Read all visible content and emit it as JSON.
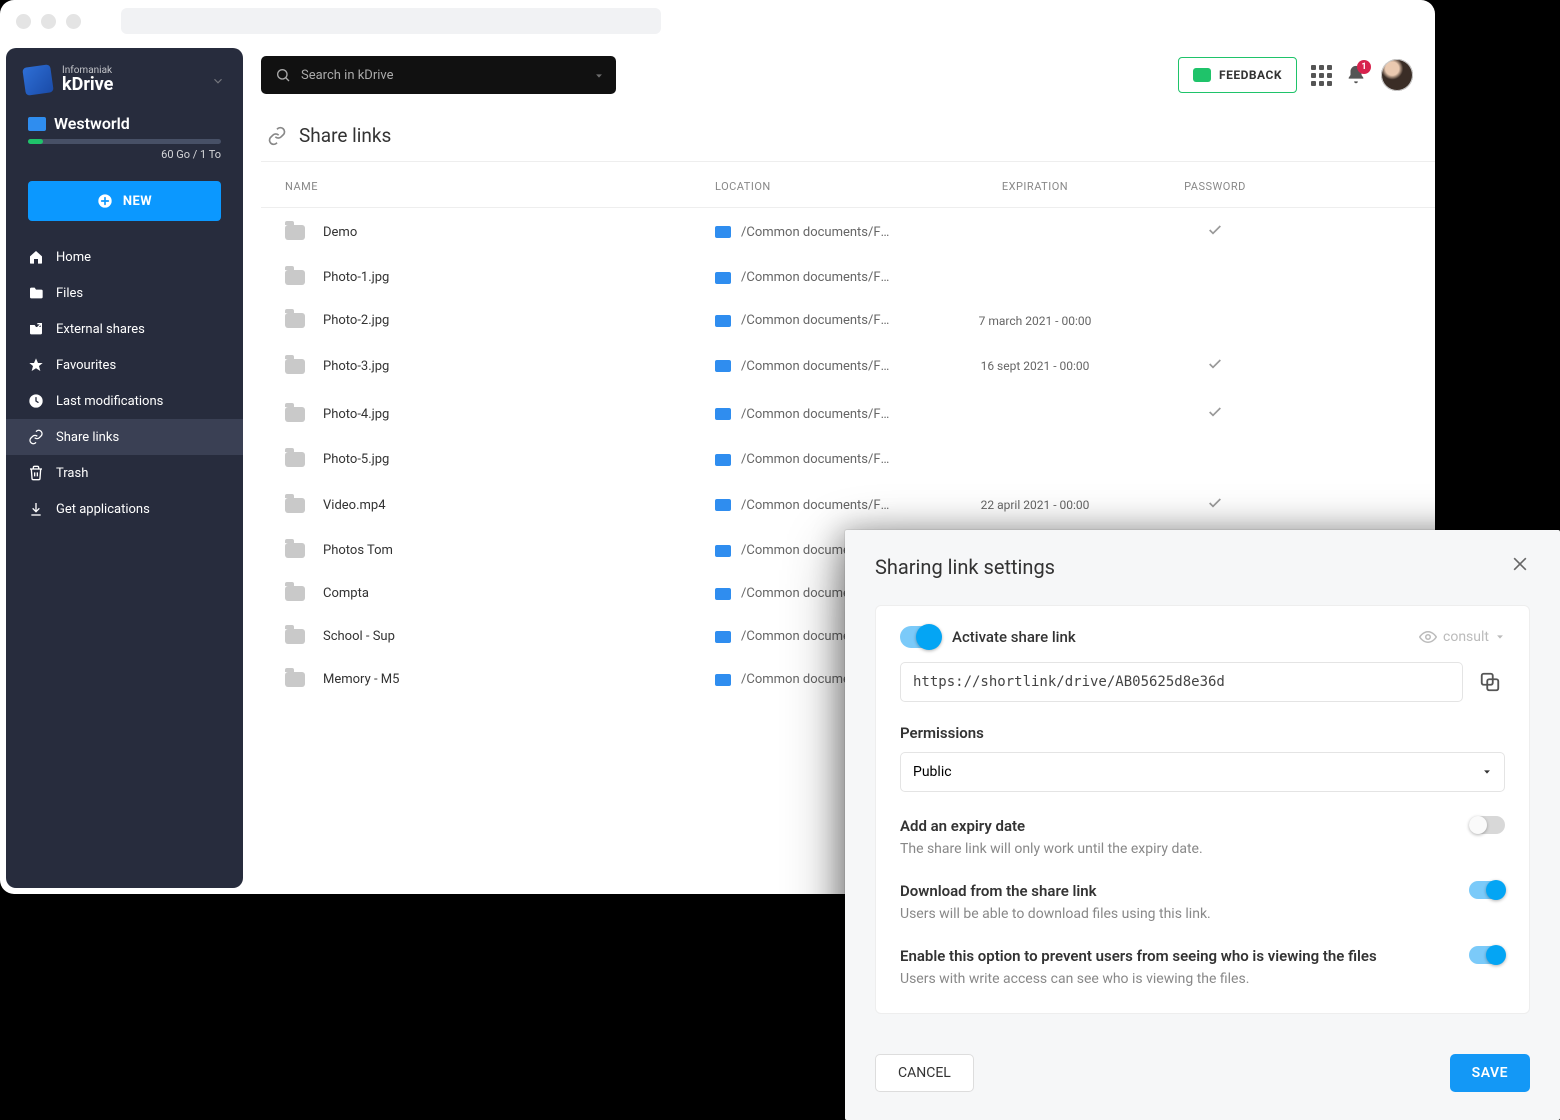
{
  "brand": {
    "top": "Infomaniak",
    "name": "kDrive"
  },
  "drive": {
    "name": "Westworld",
    "storage": "60 Go / 1 To"
  },
  "new_btn": "NEW",
  "nav": [
    {
      "label": "Home",
      "icon": "home"
    },
    {
      "label": "Files",
      "icon": "folder"
    },
    {
      "label": "External shares",
      "icon": "ext"
    },
    {
      "label": "Favourites",
      "icon": "star"
    },
    {
      "label": "Last modifications",
      "icon": "clock"
    },
    {
      "label": "Share links",
      "icon": "link",
      "active": true
    },
    {
      "label": "Trash",
      "icon": "trash"
    },
    {
      "label": "Get applications",
      "icon": "download"
    }
  ],
  "search_placeholder": "Search in kDrive",
  "feedback": "FEEDBACK",
  "notif_count": "1",
  "page_title": "Share links",
  "cols": {
    "name": "NAME",
    "location": "LOCATION",
    "expiration": "EXPIRATION",
    "password": "PASSWORD"
  },
  "rows": [
    {
      "name": "Demo",
      "location": "/Common documents/Files...",
      "expiration": "",
      "password": true
    },
    {
      "name": "Photo-1.jpg",
      "location": "/Common documents/Files...",
      "expiration": "",
      "password": false
    },
    {
      "name": "Photo-2.jpg",
      "location": "/Common documents/Files...",
      "expiration": "7 march 2021 - 00:00",
      "password": false
    },
    {
      "name": "Photo-3.jpg",
      "location": "/Common documents/Files...",
      "expiration": "16 sept 2021 - 00:00",
      "password": true
    },
    {
      "name": "Photo-4.jpg",
      "location": "/Common documents/Files...",
      "expiration": "",
      "password": true
    },
    {
      "name": "Photo-5.jpg",
      "location": "/Common documents/Files...",
      "expiration": "",
      "password": false
    },
    {
      "name": "Video.mp4",
      "location": "/Common documents/Files...",
      "expiration": "22 april 2021 - 00:00",
      "password": true
    },
    {
      "name": "Photos Tom",
      "location": "/Common documents/File",
      "expiration": "",
      "password": false
    },
    {
      "name": "Compta",
      "location": "/Common documents/File",
      "expiration": "",
      "password": false
    },
    {
      "name": "School - Sup",
      "location": "/Common documents/File",
      "expiration": "",
      "password": false
    },
    {
      "name": "Memory - M5",
      "location": "/Common documents/File",
      "expiration": "",
      "password": false
    }
  ],
  "modal": {
    "title": "Sharing link settings",
    "activate": "Activate share link",
    "consult": "consult",
    "link": "https://shortlink/drive/AB05625d8e36d",
    "perm_label": "Permissions",
    "perm_value": "Public",
    "opts": [
      {
        "title": "Add an expiry date",
        "desc": "The share link will only work until the expiry date.",
        "on": false
      },
      {
        "title": "Download from the share link",
        "desc": "Users will be able to download files using this link.",
        "on": true
      },
      {
        "title": "Enable this option to prevent users from seeing who is viewing the files",
        "desc": "Users with write access can see who is viewing the files.",
        "on": true
      }
    ],
    "cancel": "CANCEL",
    "save": "SAVE"
  }
}
